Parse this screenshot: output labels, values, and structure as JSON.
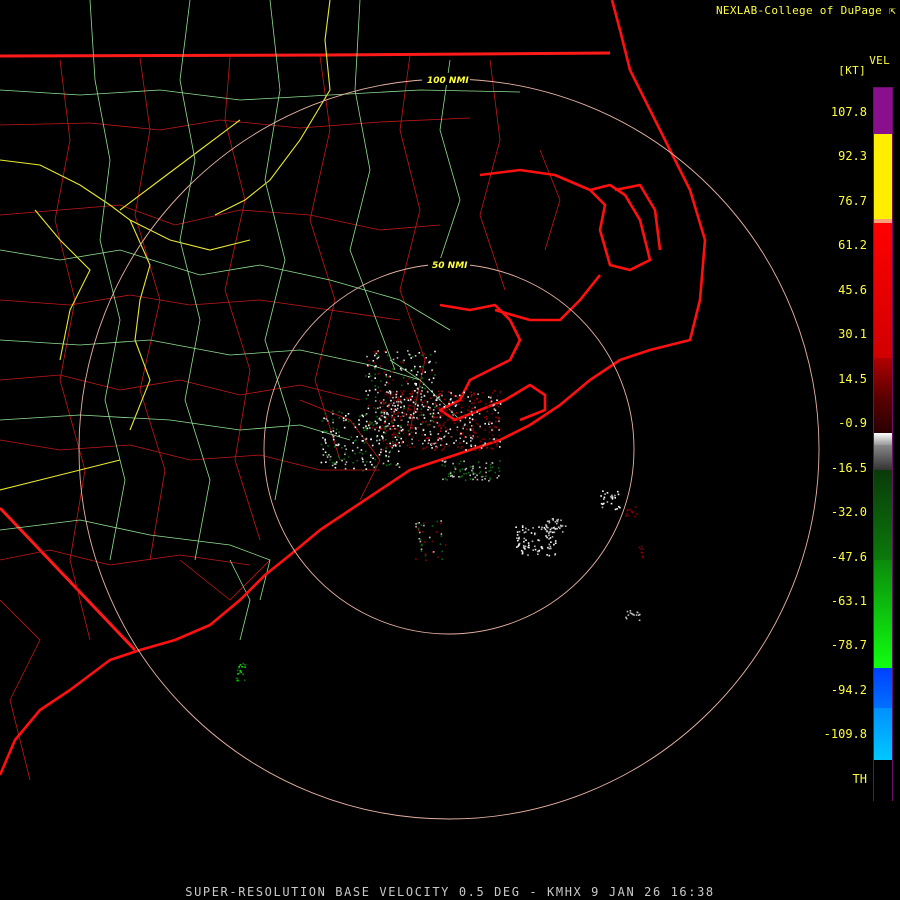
{
  "header": {
    "credit": "NEXLAB-College of DuPage",
    "credit_icon": "external-link-icon"
  },
  "legend": {
    "product": "VEL",
    "units": "[KT]",
    "ticks": [
      "107.8",
      "92.3",
      "76.7",
      "61.2",
      "45.6",
      "30.1",
      "14.5",
      "-0.9",
      "-16.5",
      "-32.0",
      "-47.6",
      "-63.1",
      "-78.7",
      "-94.2",
      "-109.8",
      "TH"
    ],
    "colors": {
      "purple": "#8a0f8c",
      "yellow": "#ffee00",
      "orange": "#f7a177",
      "red": "#ff0000",
      "darkred": "#7a0000",
      "gray": "#bdbdbd",
      "darkgreen": "#0b6b0b",
      "green": "#0ee60e",
      "blue": "#0057ff",
      "lightblue": "#0aa6ff",
      "th": "#000000"
    }
  },
  "range_rings": [
    {
      "label": "100 NMI"
    },
    {
      "label": "50 NMI"
    }
  ],
  "footer": {
    "caption": "SUPER-RESOLUTION BASE VELOCITY 0.5 DEG - KMHX 9 JAN 26 16:38"
  }
}
